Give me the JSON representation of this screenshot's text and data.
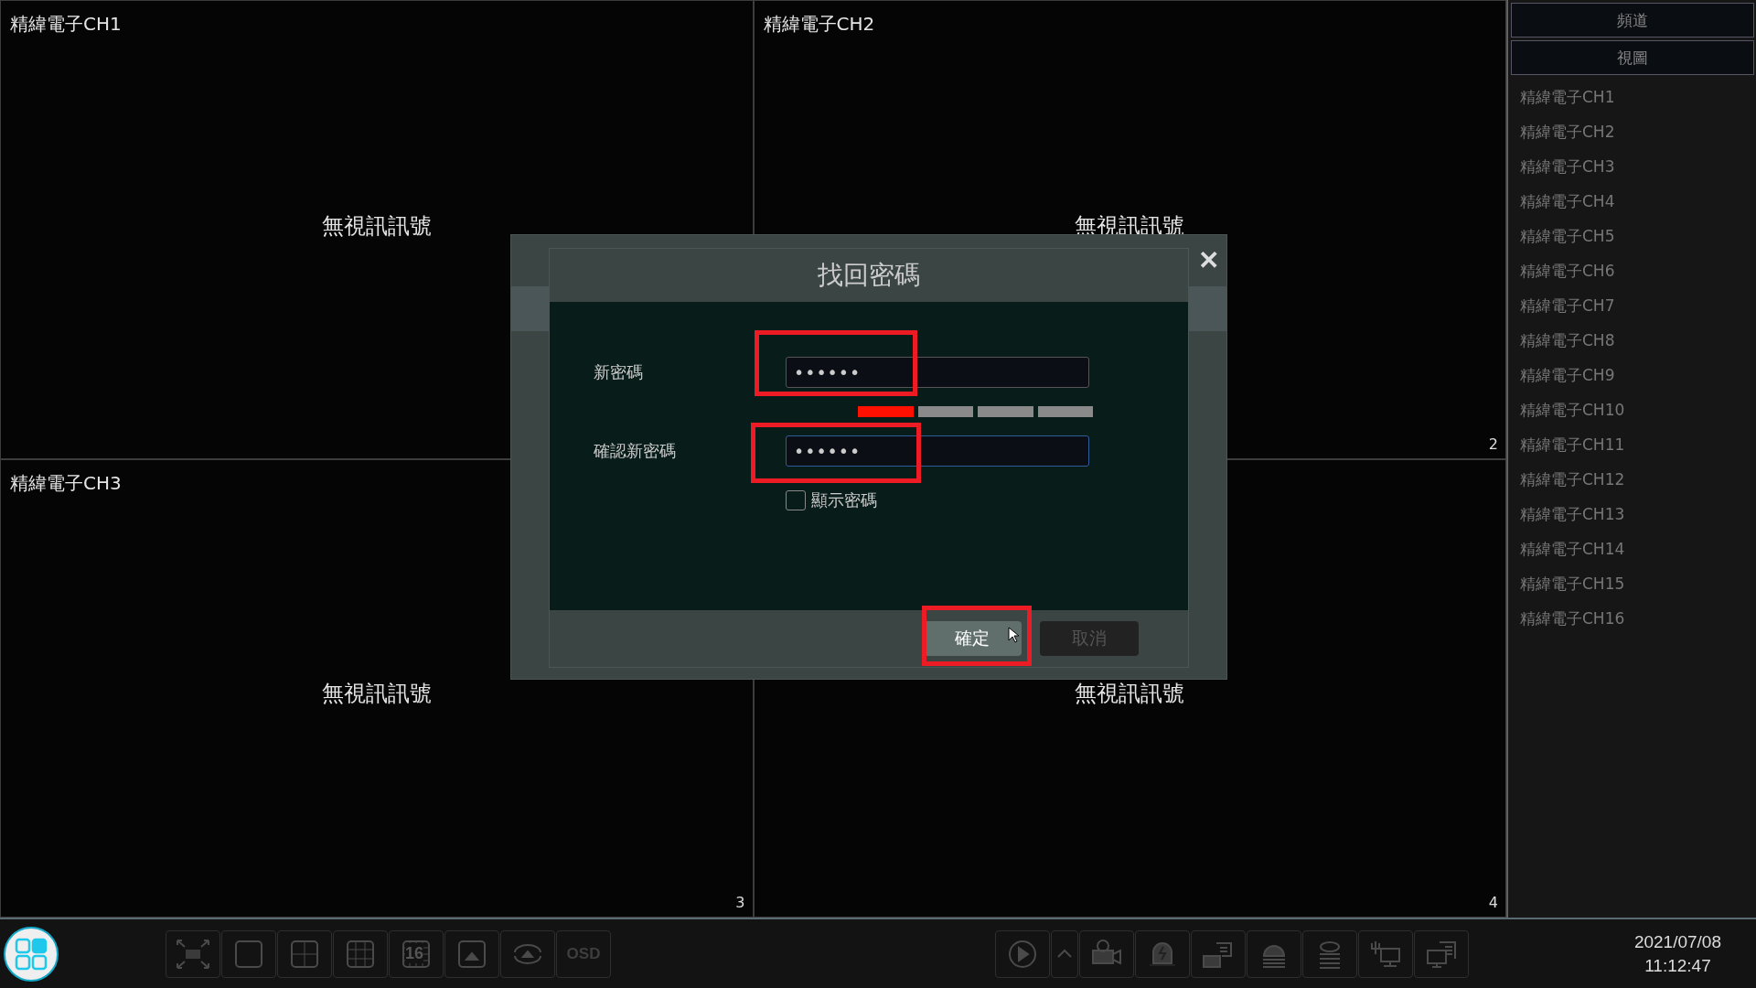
{
  "tiles": [
    {
      "title": "精緯電子CH1",
      "status": "無視訊訊號"
    },
    {
      "title": "精緯電子CH2",
      "status": "無視訊訊號",
      "number": "2"
    },
    {
      "title": "精緯電子CH3",
      "status": "無視訊訊號",
      "number": "3"
    },
    {
      "status": "無視訊訊號",
      "number": "4"
    }
  ],
  "dialog": {
    "title": "找回密碼",
    "close": "✕",
    "fields": [
      {
        "label": "新密碼",
        "value": "••••••",
        "focused": false
      },
      {
        "label": "確認新密碼",
        "value": "••••••",
        "focused": true
      }
    ],
    "strength": {
      "level": 0.25
    },
    "show_password": {
      "label": "顯示密碼",
      "checked": false
    },
    "buttons": [
      {
        "label": "確定",
        "disabled": false
      },
      {
        "label": "取消",
        "disabled": true
      }
    ]
  },
  "sidebar": {
    "tabs": [
      {
        "label": "頻道",
        "selected": false
      },
      {
        "label": "視圖",
        "selected": false
      }
    ],
    "items": [
      "精緯電子CH1",
      "精緯電子CH2",
      "精緯電子CH3",
      "精緯電子CH4",
      "精緯電子CH5",
      "精緯電子CH6",
      "精緯電子CH7",
      "精緯電子CH8",
      "精緯電子CH9",
      "精緯電子CH10",
      "精緯電子CH11",
      "精緯電子CH12",
      "精緯電子CH13",
      "精緯電子CH14",
      "精緯電子CH15",
      "精緯電子CH16"
    ]
  },
  "toolbar_left": [
    {
      "kind": "fullscreen"
    },
    {
      "kind": "split1"
    },
    {
      "kind": "split4"
    },
    {
      "kind": "split9"
    },
    {
      "kind": "split16",
      "label": "16"
    },
    {
      "kind": "pip"
    },
    {
      "kind": "cycle"
    },
    {
      "kind": "osd",
      "label": "OSD"
    }
  ],
  "toolbar_right": [
    {
      "kind": "play"
    },
    {
      "kind": "caret"
    },
    {
      "kind": "camera"
    },
    {
      "kind": "alarm"
    },
    {
      "kind": "record"
    },
    {
      "kind": "backup"
    },
    {
      "kind": "disk"
    },
    {
      "kind": "network"
    },
    {
      "kind": "monitor"
    }
  ],
  "clock": {
    "date": "2021/07/08",
    "time": "11:12:47"
  }
}
